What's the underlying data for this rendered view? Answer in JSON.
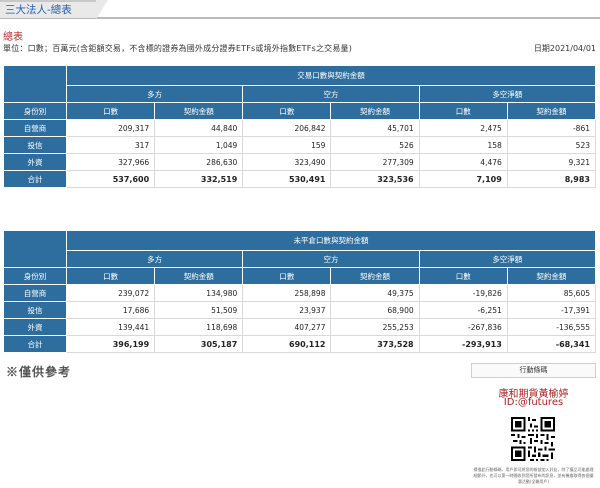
{
  "tab": {
    "label": "三大法人-總表"
  },
  "section_title": "總表",
  "unit_line": "單位：口數；百萬元(含鉅額交易，不含標的證券為國外成分證券ETFs或境外指數ETFs之交易量)",
  "date_line": "日期2021/04/01",
  "table1": {
    "caption": "交易口數與契約金額",
    "identity_header": "身份別",
    "groups": [
      "多方",
      "空方",
      "多空淨額"
    ],
    "columns": [
      "口數",
      "契約金額",
      "口數",
      "契約金額",
      "口數",
      "契約金額"
    ],
    "rows": [
      {
        "label": "自營商",
        "values": [
          "209,317",
          "44,840",
          "206,842",
          "45,701",
          "2,475",
          "-861"
        ]
      },
      {
        "label": "投信",
        "values": [
          "317",
          "1,049",
          "159",
          "526",
          "158",
          "523"
        ]
      },
      {
        "label": "外資",
        "values": [
          "327,966",
          "286,630",
          "323,490",
          "277,309",
          "4,476",
          "9,321"
        ]
      },
      {
        "label": "合計",
        "values": [
          "537,600",
          "332,519",
          "530,491",
          "323,536",
          "7,109",
          "8,983"
        ]
      }
    ]
  },
  "table2": {
    "caption": "未平倉口數與契約金額",
    "identity_header": "身份別",
    "groups": [
      "多方",
      "空方",
      "多空淨額"
    ],
    "columns": [
      "口數",
      "契約金額",
      "口數",
      "契約金額",
      "口數",
      "契約金額"
    ],
    "rows": [
      {
        "label": "自營商",
        "values": [
          "239,072",
          "134,980",
          "258,898",
          "49,375",
          "-19,826",
          "85,605"
        ]
      },
      {
        "label": "投信",
        "values": [
          "17,686",
          "51,509",
          "23,937",
          "68,900",
          "-6,251",
          "-17,391"
        ]
      },
      {
        "label": "外資",
        "values": [
          "139,441",
          "118,698",
          "407,277",
          "255,253",
          "-267,836",
          "-136,555"
        ]
      },
      {
        "label": "合計",
        "values": [
          "396,199",
          "305,187",
          "690,112",
          "373,528",
          "-293,913",
          "-68,341"
        ]
      }
    ]
  },
  "note": "※僅供參考",
  "ad": {
    "bar_label": "行動條碼",
    "name": "康和期貨黃榆婷",
    "id": "ID:@futures",
    "fine_print": "掃描此行動條碼，用戶即可將您的帳號加入好友，除了獲品可能處理細節外，也可以第一時間收到您所發布的訊息，並有機會取得各個優惠活動(全聯用戶)",
    "accent_color": "#b11f1f"
  },
  "colors": {
    "header_blue": "#2e6e9e",
    "title_red": "#c0272d"
  }
}
